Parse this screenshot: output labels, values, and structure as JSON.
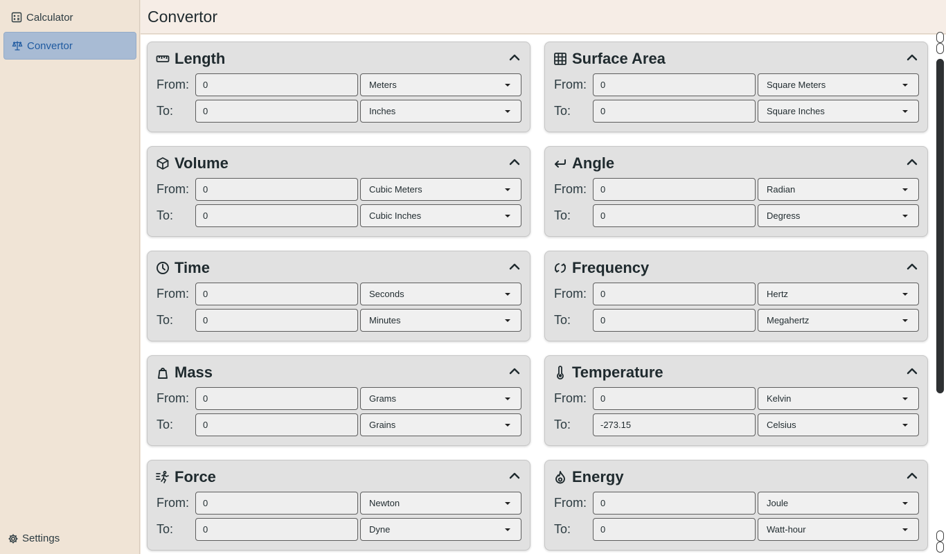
{
  "nav": {
    "calculator_label": "Calculator",
    "convertor_label": "Convertor",
    "settings_label": "Settings"
  },
  "header": {
    "title": "Convertor"
  },
  "labels": {
    "from": "From:",
    "to": "To:"
  },
  "cards": [
    {
      "title": "Length",
      "icon": "ruler-icon",
      "from_value": "0",
      "from_unit": "Meters",
      "to_value": "0",
      "to_unit": "Inches"
    },
    {
      "title": "Surface Area",
      "icon": "grid-icon",
      "from_value": "0",
      "from_unit": "Square Meters",
      "to_value": "0",
      "to_unit": "Square Inches"
    },
    {
      "title": "Volume",
      "icon": "cube-icon",
      "from_value": "0",
      "from_unit": "Cubic Meters",
      "to_value": "0",
      "to_unit": "Cubic Inches"
    },
    {
      "title": "Angle",
      "icon": "return-arrow-icon",
      "from_value": "0",
      "from_unit": "Radian",
      "to_value": "0",
      "to_unit": "Degress"
    },
    {
      "title": "Time",
      "icon": "clock-icon",
      "from_value": "0",
      "from_unit": "Seconds",
      "to_value": "0",
      "to_unit": "Minutes"
    },
    {
      "title": "Frequency",
      "icon": "cycle-icon",
      "from_value": "0",
      "from_unit": "Hertz",
      "to_value": "0",
      "to_unit": "Megahertz"
    },
    {
      "title": "Mass",
      "icon": "weight-icon",
      "from_value": "0",
      "from_unit": "Grams",
      "to_value": "0",
      "to_unit": "Grains"
    },
    {
      "title": "Temperature",
      "icon": "thermometer-icon",
      "from_value": "0",
      "from_unit": "Kelvin",
      "to_value": "-273.15",
      "to_unit": "Celsius"
    },
    {
      "title": "Force",
      "icon": "force-icon",
      "from_value": "0",
      "from_unit": "Newton",
      "to_value": "0",
      "to_unit": "Dyne"
    },
    {
      "title": "Energy",
      "icon": "flame-icon",
      "from_value": "0",
      "from_unit": "Joule",
      "to_value": "0",
      "to_unit": "Watt-hour"
    }
  ],
  "colors": {
    "sidebar_bg": "#f0e4d6",
    "active_nav_bg": "#a8bbd4",
    "active_nav_text": "#1f5aa0",
    "card_bg": "#e1e1e1",
    "header_bg": "#f6ede6"
  }
}
